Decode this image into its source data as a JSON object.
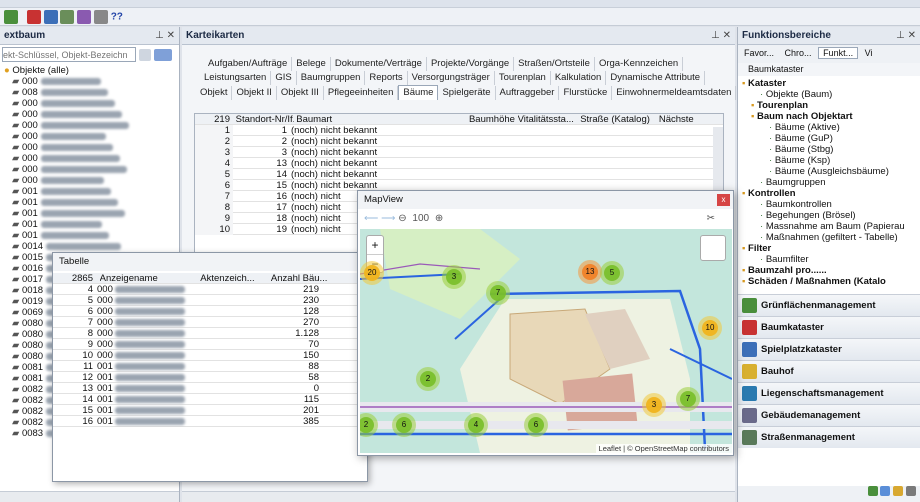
{
  "toolbar": {
    "help": "??"
  },
  "left": {
    "title": "extbaum",
    "pin": "⊥ ✕",
    "search_placeholder": "ekt-Schlüssel, Objekt-Bezeichn",
    "root": "Objekte (alle)",
    "rows": [
      "000",
      "008",
      "000",
      "000",
      "000",
      "000",
      "000",
      "000",
      "000",
      "000",
      "001",
      "001",
      "001",
      "001",
      "001",
      "0014",
      "0015",
      "0016",
      "0017",
      "0018",
      "0019",
      "0069",
      "0080",
      "0080",
      "0080",
      "0080",
      "0081",
      "0081",
      "0082",
      "0082",
      "0082",
      "0082",
      "0083"
    ]
  },
  "kartei": {
    "title": "Karteikarten",
    "pin": "⊥ ✕",
    "tabs_row1": [
      "Aufgaben/Aufträge",
      "Belege",
      "Dokumente/Verträge",
      "Projekte/Vorgänge",
      "Straßen/Ortsteile",
      "Orga-Kennzeichen"
    ],
    "tabs_row2": [
      "Leistungsarten",
      "GIS",
      "Baumgruppen",
      "Reports",
      "Versorgungsträger",
      "Tourenplan",
      "Kalkulation",
      "Dynamische Attribute"
    ],
    "tabs_row3": [
      "Objekt",
      "Objekt II",
      "Objekt III",
      "Pflegeeinheiten",
      "Bäume",
      "Spielgeräte",
      "Auftraggeber",
      "Flurstücke",
      "Einwohnermeldeamtsdaten"
    ],
    "selected_tab": "Bäume",
    "grid": {
      "count": "219",
      "headers": [
        "Standort-Nr/If...",
        "Baumart",
        "Baumhöhe",
        "Vitalitätssta...",
        "Straße (Katalog)",
        "Nächste"
      ],
      "rows": [
        [
          "1",
          "1",
          "(noch) nicht bekannt"
        ],
        [
          "2",
          "2",
          "(noch) nicht bekannt"
        ],
        [
          "3",
          "3",
          "(noch) nicht bekannt"
        ],
        [
          "4",
          "13",
          "(noch) nicht bekannt"
        ],
        [
          "5",
          "14",
          "(noch) nicht bekannt"
        ],
        [
          "6",
          "15",
          "(noch) nicht bekannt"
        ],
        [
          "7",
          "16",
          "(noch) nicht"
        ],
        [
          "8",
          "17",
          "(noch) nicht"
        ],
        [
          "9",
          "18",
          "(noch) nicht"
        ],
        [
          "10",
          "19",
          "(noch) nicht"
        ]
      ]
    }
  },
  "tabelle": {
    "title": "Tabelle",
    "count": "2865",
    "headers": [
      "Anzeigename",
      "Aktenzeich...",
      "Anzahl Bäu..."
    ],
    "rows": [
      [
        "4",
        "000",
        "219"
      ],
      [
        "5",
        "000",
        "230"
      ],
      [
        "6",
        "000",
        "128"
      ],
      [
        "7",
        "000",
        "270"
      ],
      [
        "8",
        "000",
        "1.128"
      ],
      [
        "9",
        "000",
        "70"
      ],
      [
        "10",
        "000",
        "150"
      ],
      [
        "11",
        "001",
        "88"
      ],
      [
        "12",
        "001",
        "58"
      ],
      [
        "13",
        "001",
        "0"
      ],
      [
        "14",
        "001",
        "115"
      ],
      [
        "15",
        "001",
        "201"
      ],
      [
        "16",
        "001",
        "385"
      ]
    ]
  },
  "mapview": {
    "title": "MapView",
    "zoom": "100",
    "close": "x",
    "plus": "+",
    "minus": "−",
    "attribution": "Leaflet | © OpenStreetMap contributors",
    "clusters": [
      "20",
      "3",
      "13",
      "5",
      "7",
      "10",
      "2",
      "3",
      "7",
      "2",
      "6",
      "4",
      "6"
    ]
  },
  "right": {
    "title": "Funktionsbereiche",
    "pin": "⊥ ✕",
    "tabs": [
      "Favor...",
      "Chro...",
      "Funkt...",
      "Vi"
    ],
    "section": "Baumkataster",
    "tree": [
      {
        "t": "Kataster",
        "b": true,
        "d": 0
      },
      {
        "t": "Objekte (Baum)",
        "d": 2
      },
      {
        "t": "Tourenplan",
        "b": true,
        "d": 1
      },
      {
        "t": "Baum nach Objektart",
        "b": true,
        "d": 1
      },
      {
        "t": "Bäume (Aktive)",
        "d": 3
      },
      {
        "t": "Bäume (GuP)",
        "d": 3
      },
      {
        "t": "Bäume (Stbg)",
        "d": 3
      },
      {
        "t": "Bäume (Ksp)",
        "d": 3
      },
      {
        "t": "Bäume (Ausgleichsbäume)",
        "d": 3
      },
      {
        "t": "Baumgruppen",
        "d": 2
      },
      {
        "t": "Kontrollen",
        "b": true,
        "d": 0
      },
      {
        "t": "Baumkontrollen",
        "d": 2
      },
      {
        "t": "Begehungen (Brösel)",
        "d": 2
      },
      {
        "t": "Massnahme am Baum (Papierau",
        "d": 2
      },
      {
        "t": "Maßnahmen (gefiltert - Tabelle)",
        "d": 2
      },
      {
        "t": "Filter",
        "b": true,
        "d": 0
      },
      {
        "t": "Baumfilter",
        "d": 2
      },
      {
        "t": "Baumzahl pro......",
        "b": true,
        "d": 0
      },
      {
        "t": "Schäden / Maßnahmen (Katalo",
        "b": true,
        "d": 0
      }
    ],
    "modules": [
      "Grünflächenmanagement",
      "Baumkataster",
      "Spielplatzkataster",
      "Bauhof",
      "Liegenschaftsmanagement",
      "Gebäudemanagement",
      "Straßenmanagement"
    ]
  }
}
